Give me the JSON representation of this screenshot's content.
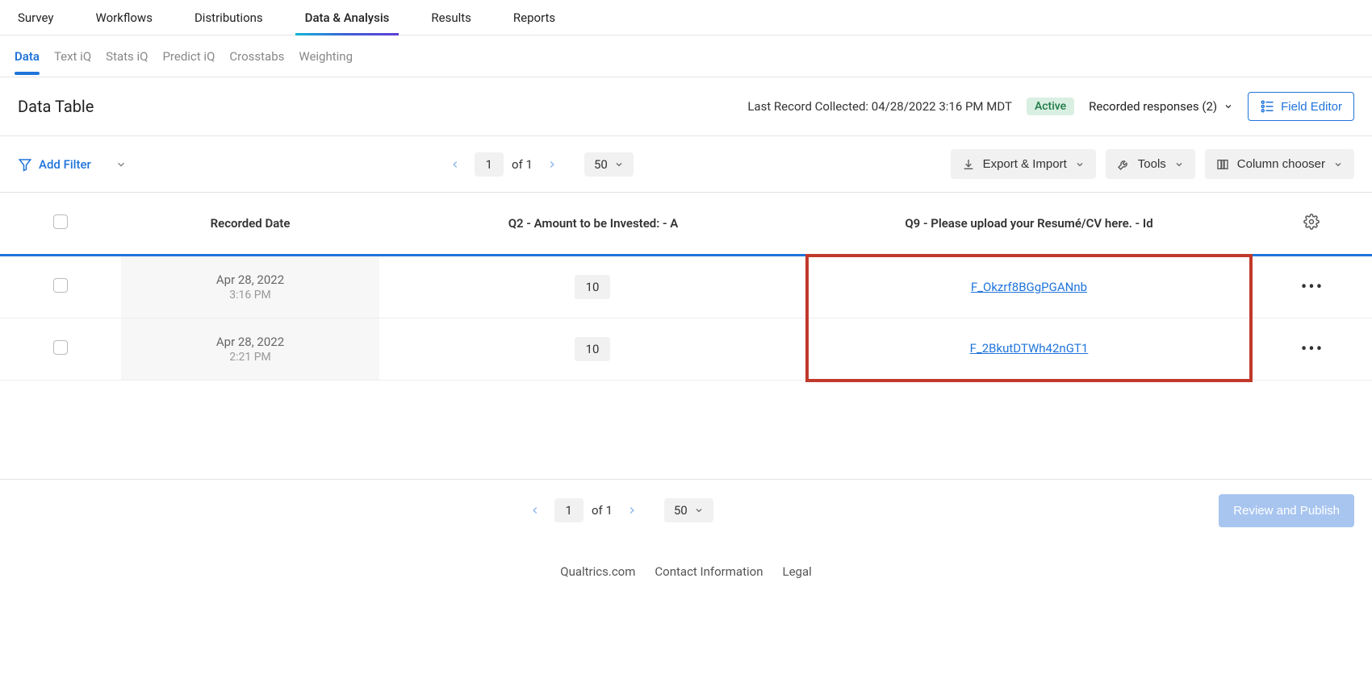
{
  "topnav": [
    "Survey",
    "Workflows",
    "Distributions",
    "Data & Analysis",
    "Results",
    "Reports"
  ],
  "topnav_active": 3,
  "subnav": [
    "Data",
    "Text iQ",
    "Stats iQ",
    "Predict iQ",
    "Crosstabs",
    "Weighting"
  ],
  "subnav_active": 0,
  "title": "Data Table",
  "last_record_label": "Last Record Collected:",
  "last_record_value": "04/28/2022 3:16 PM MDT",
  "status": "Active",
  "recorded_responses_label": "Recorded responses (2)",
  "field_editor_label": "Field Editor",
  "add_filter_label": "Add Filter",
  "pager": {
    "current": "1",
    "of": "of 1",
    "page_size": "50"
  },
  "actions": {
    "export_import": "Export & Import",
    "tools": "Tools",
    "column_chooser": "Column chooser"
  },
  "columns": {
    "date": "Recorded Date",
    "q2": "Q2 - Amount to be Invested: - A",
    "q9": "Q9 - Please upload your Resumé/CV here. - Id"
  },
  "rows": [
    {
      "date": "Apr 28, 2022",
      "time": "3:16 PM",
      "amount": "10",
      "file": "F_Okzrf8BGgPGANnb"
    },
    {
      "date": "Apr 28, 2022",
      "time": "2:21 PM",
      "amount": "10",
      "file": "F_2BkutDTWh42nGT1"
    }
  ],
  "review_publish": "Review and Publish",
  "footer": [
    "Qualtrics.com",
    "Contact Information",
    "Legal"
  ]
}
